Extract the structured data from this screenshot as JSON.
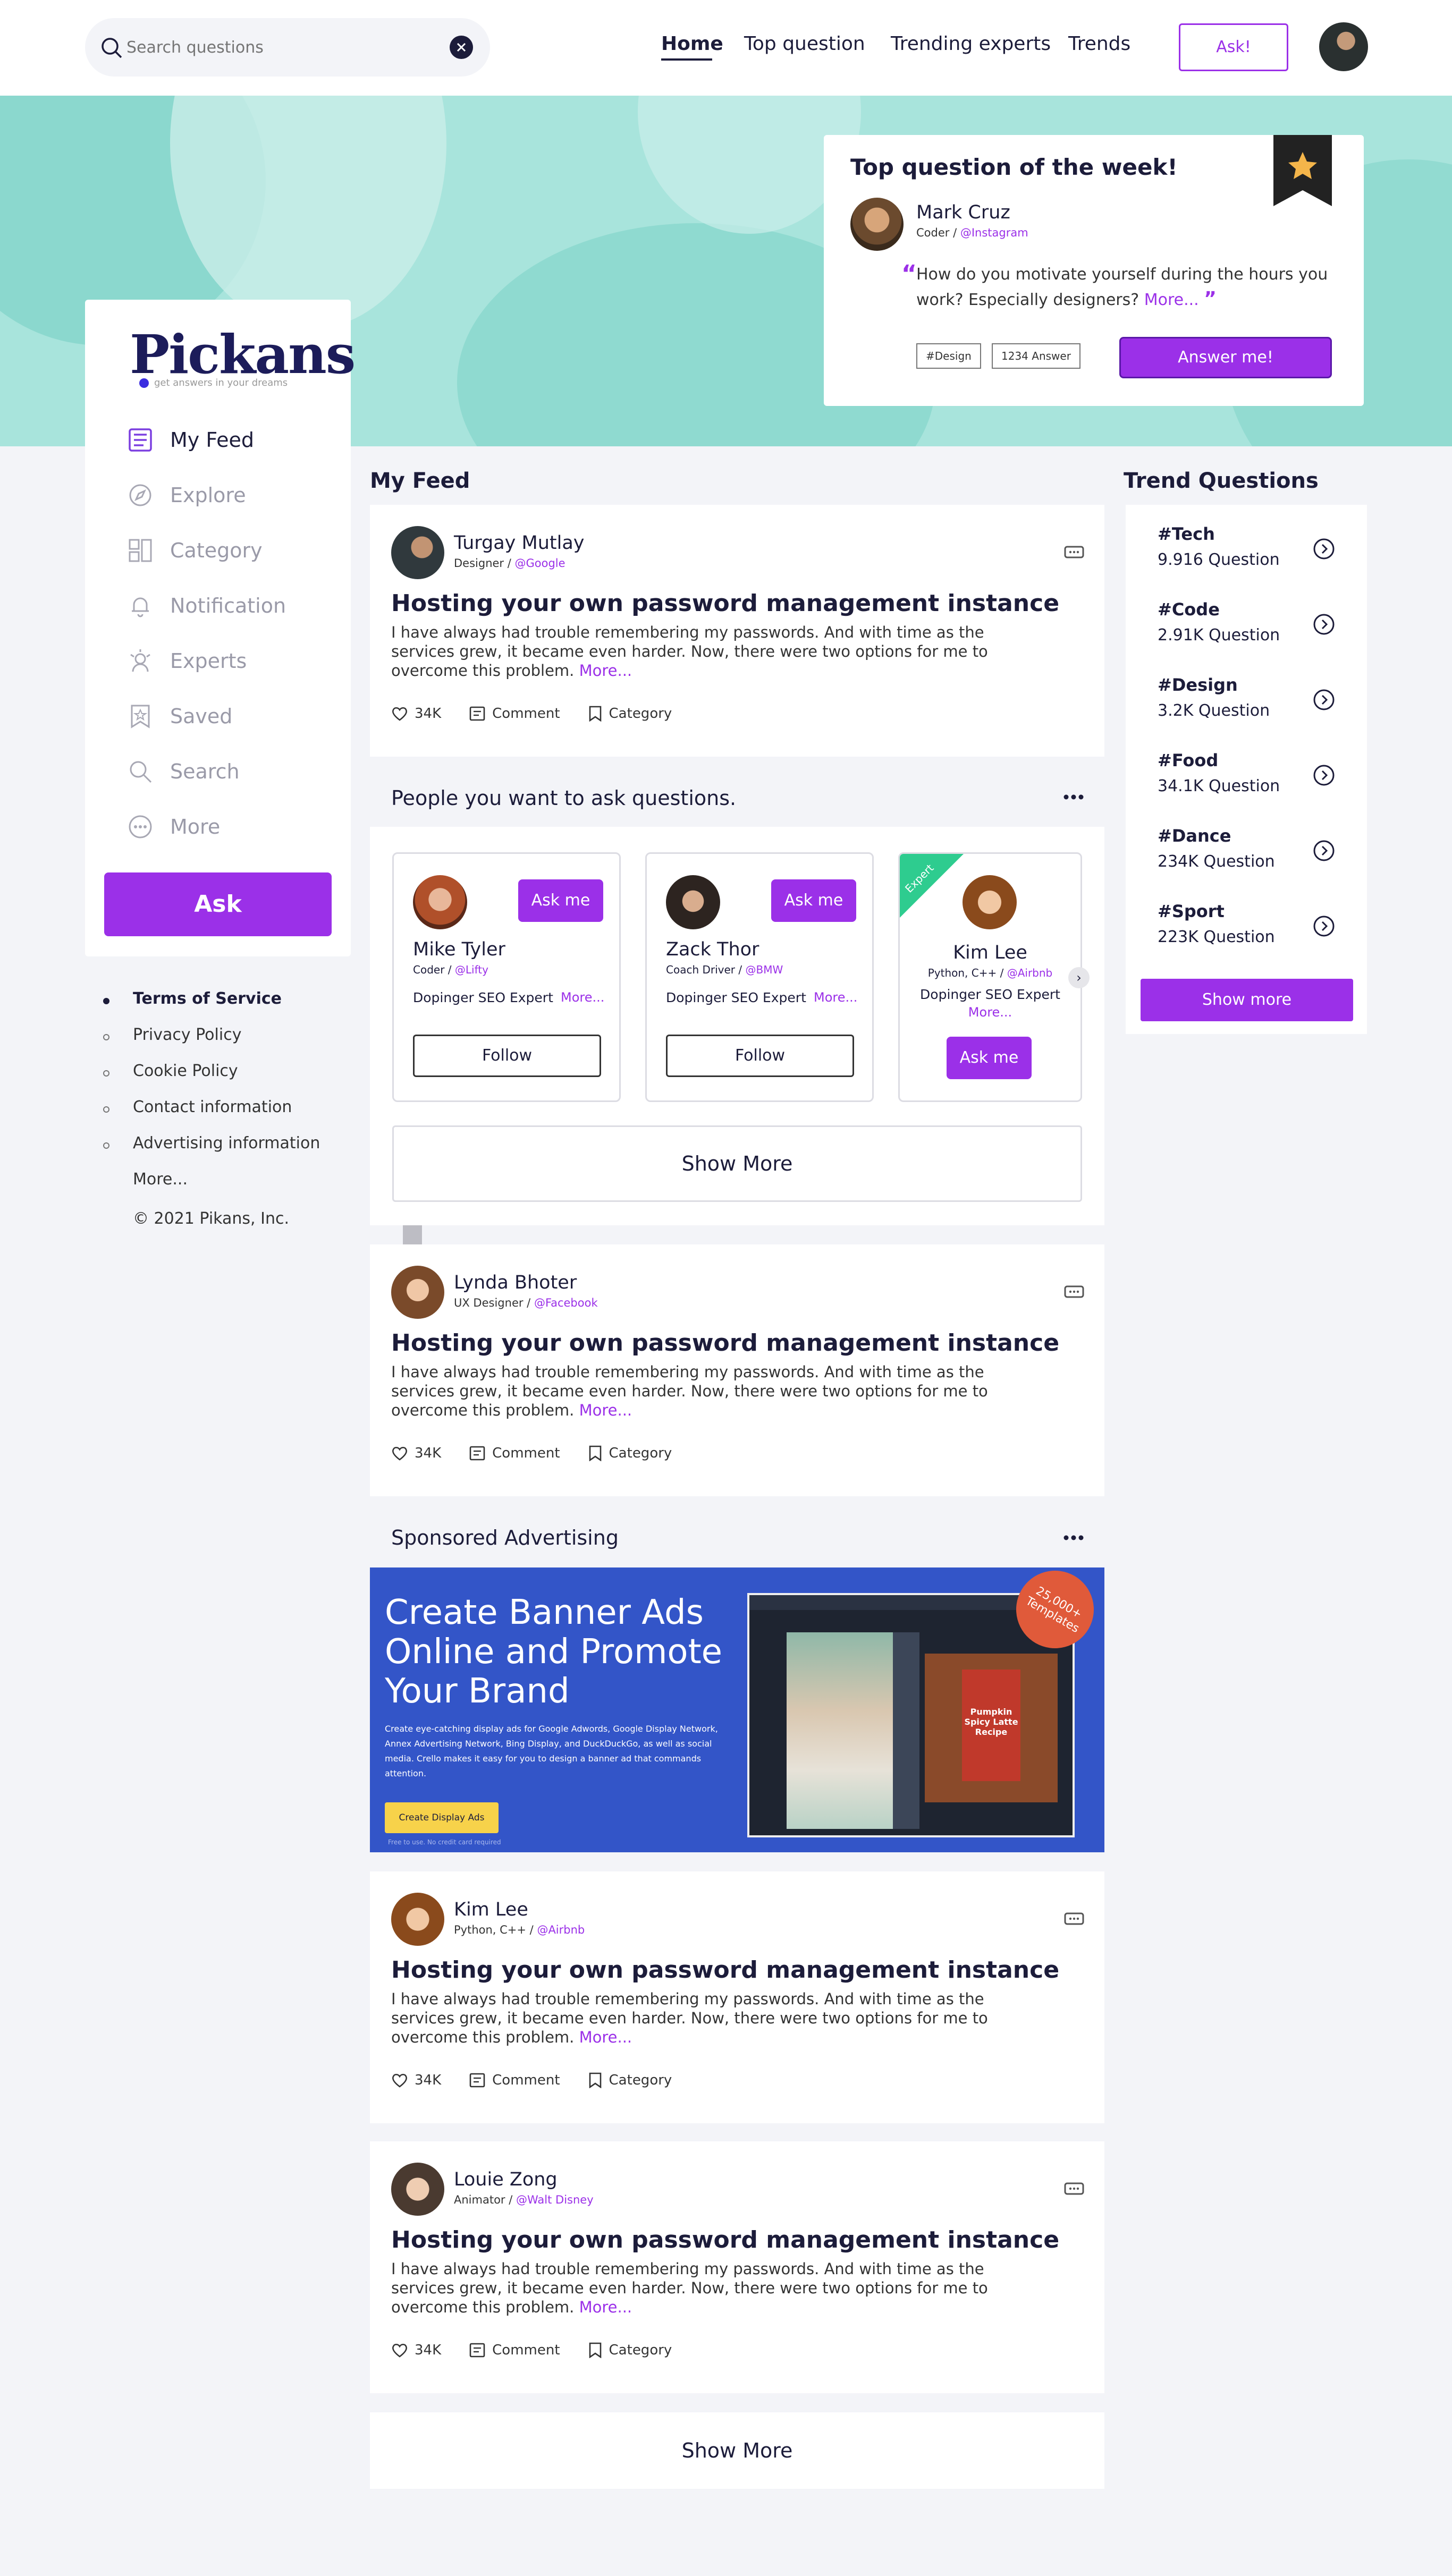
{
  "header": {
    "search_placeholder": "Search questions",
    "nav": [
      "Home",
      "Top question",
      "Trending experts",
      "Trends"
    ],
    "ask_label": "Ask!"
  },
  "featured": {
    "heading": "Top question of the week!",
    "author": "Mark Cruz",
    "role": "Coder",
    "handle": "@Instagram",
    "question": "How do you motivate yourself during the hours you work? Especially designers?",
    "more": "More...",
    "tags": [
      "#Design",
      "1234 Answer"
    ],
    "answer_label": "Answer me!"
  },
  "brand": {
    "logo": "Pickans",
    "tagline": "get answers in your dreams"
  },
  "sidebar": {
    "items": [
      "My Feed",
      "Explore",
      "Category",
      "Notification",
      "Experts",
      "Saved",
      "Search",
      "More"
    ],
    "ask_label": "Ask"
  },
  "footer": {
    "links": [
      "Terms of Service",
      "Privacy Policy",
      "Cookie Policy",
      "Contact information",
      "Advertising information"
    ],
    "more": "More...",
    "copyright": "© 2021 Pikans, Inc."
  },
  "feed": {
    "title": "My Feed",
    "posts": [
      {
        "name": "Turgay Mutlay",
        "role": "Designer",
        "handle": "@Google",
        "title": "Hosting your own password management instance",
        "body": "I have always had trouble remembering my passwords. And with time as the services grew, it became even harder. Now, there were two options for me to overcome this problem.",
        "more": "More...",
        "likes": "34K",
        "comment": "Comment",
        "category": "Category"
      },
      {
        "name": "Lynda Bhoter",
        "role": "UX Designer",
        "handle": "@Facebook",
        "title": "Hosting your own password management instance",
        "body": "I have always had trouble remembering my passwords. And with time as the services grew, it became even harder. Now, there were two options for me to overcome this problem.",
        "more": "More...",
        "likes": "34K",
        "comment": "Comment",
        "category": "Category"
      },
      {
        "name": "Kim Lee",
        "role": "Python, C++",
        "handle": "@Airbnb",
        "title": "Hosting your own password management instance",
        "body": "I have always had trouble remembering my passwords. And with time as the services grew, it became even harder. Now, there were two options for me to overcome this problem.",
        "more": "More...",
        "likes": "34K",
        "comment": "Comment",
        "category": "Category"
      },
      {
        "name": "Louie Zong",
        "role": "Animator",
        "handle": "@Walt Disney",
        "title": "Hosting your own password management instance",
        "body": "I have always had trouble remembering my passwords. And with time as the services grew, it became even harder. Now, there were two options for me to overcome this problem.",
        "more": "More...",
        "likes": "34K",
        "comment": "Comment",
        "category": "Category"
      }
    ],
    "show_more": "Show More"
  },
  "people": {
    "title": "People you want to ask questions.",
    "cards": [
      {
        "name": "Mike Tyler",
        "role": "Coder",
        "handle": "@Lifty",
        "desc": "Dopinger SEO Expert",
        "more": "More...",
        "ask": "Ask me",
        "follow": "Follow"
      },
      {
        "name": "Zack Thor",
        "role": "Coach Driver",
        "handle": "@BMW",
        "desc": "Dopinger SEO Expert",
        "more": "More...",
        "ask": "Ask me",
        "follow": "Follow"
      },
      {
        "name": "Kim Lee",
        "role": "Python, C++",
        "handle": "@Airbnb",
        "desc": "Dopinger SEO Expert",
        "more": "More...",
        "ask": "Ask me",
        "badge": "Expert"
      }
    ],
    "show_more": "Show More"
  },
  "ad": {
    "title": "Sponsored Advertising",
    "headline": "Create Banner Ads Online and Promote Your Brand",
    "body": "Create eye-catching display ads for Google Adwords, Google Display Network, Annex Advertising Network, Bing Display, and DuckDuckGo, as well as social media. Crello makes it easy for you to design a banner ad that commands attention.",
    "cta": "Create Display Ads",
    "fine_print": "Free to use. No credit card required",
    "stamp": "25,000+ Templates",
    "mock_recipe": "Pumpkin Spicy Latte Recipe"
  },
  "trends": {
    "title": "Trend Questions",
    "items": [
      {
        "tag": "#Tech",
        "count": "9.916 Question"
      },
      {
        "tag": "#Code",
        "count": "2.91K Question"
      },
      {
        "tag": "#Design",
        "count": "3.2K Question"
      },
      {
        "tag": "#Food",
        "count": "34.1K Question"
      },
      {
        "tag": "#Dance",
        "count": "234K Question"
      },
      {
        "tag": "#Sport",
        "count": "223K Question"
      }
    ],
    "show_more": "Show more"
  },
  "colors": {
    "accent": "#9b30e8",
    "hero": "#a8e4dc",
    "ad_bg": "#3355c8",
    "expert_badge": "#2ecc8f",
    "ad_stamp": "#e05a3a"
  }
}
